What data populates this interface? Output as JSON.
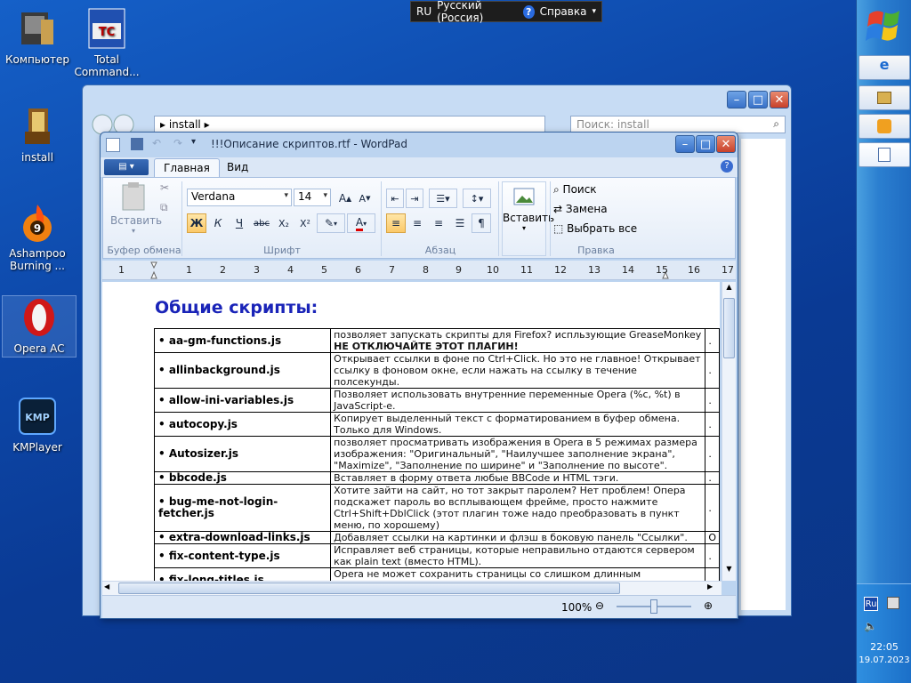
{
  "language_bar": {
    "lang_code": "RU",
    "lang_name": "Русский (Россия)",
    "help_label": "Справка"
  },
  "desktop_icons": [
    {
      "label_line1": "Компьютер",
      "label_line2": ""
    },
    {
      "label_line1": "Total",
      "label_line2": "Command..."
    },
    {
      "label_line1": "install",
      "label_line2": ""
    },
    {
      "label_line1": "Ashampoo",
      "label_line2": "Burning ..."
    },
    {
      "label_line1": "Opera AC",
      "label_line2": ""
    },
    {
      "label_line1": "KMPlayer",
      "label_line2": ""
    }
  ],
  "explorer": {
    "path": "install",
    "search_placeholder": "Поиск: install"
  },
  "wordpad": {
    "title": "!!!Описание скриптов.rtf - WordPad",
    "tabs": [
      "Главная",
      "Вид"
    ],
    "clipboard": {
      "paste_label": "Вставить",
      "group_label": "Буфер обмена"
    },
    "font": {
      "family": "Verdana",
      "size": "14",
      "group_label": "Шрифт",
      "bold": "Ж",
      "italic": "К",
      "underline": "Ч",
      "strike": "abc",
      "sub": "X₂",
      "sup": "X²"
    },
    "paragraph": {
      "group_label": "Абзац"
    },
    "insert": {
      "label": "Вставить"
    },
    "editing": {
      "find": "Поиск",
      "replace": "Замена",
      "select_all": "Выбрать все",
      "group_label": "Правка"
    },
    "ruler_numbers": [
      "1",
      "1",
      "2",
      "3",
      "4",
      "5",
      "6",
      "7",
      "8",
      "9",
      "10",
      "11",
      "12",
      "13",
      "14",
      "15",
      "16",
      "17"
    ],
    "zoom": "100%"
  },
  "document": {
    "heading": "Общие скрипты:",
    "rows": [
      {
        "name": "aa-gm-functions.js",
        "desc": "позволяет запускать скрипты для Firefox? испльзующие GreaseMonkey",
        "desc_bold": "НЕ ОТКЛЮЧАЙТЕ ЭТОТ ПЛАГИН!",
        "extra": "."
      },
      {
        "name": "allinbackground.js",
        "desc": "Открывает ссылки в фоне по Ctrl+Click. Но это не главное! Открывает ссылку в фоновом окне, если нажать на ссылку в течение полсекунды.",
        "desc_bold": "",
        "extra": "."
      },
      {
        "name": "allow-ini-variables.js",
        "desc": "Позволяет использовать внутренние переменные Opera (%c, %t) в JavaScript-e.",
        "desc_bold": "",
        "extra": "."
      },
      {
        "name": "autocopy.js",
        "desc": "Копирует выделенный текст с форматированием в буфер обмена. Только для Windows.",
        "desc_bold": "",
        "extra": "."
      },
      {
        "name": "Autosizer.js",
        "desc": "позволяет просматривать изображения в Opera в 5 режимах размера изображения: \"Оригинальный\", \"Наилучшее заполнение экрана\", \"Maximize\", \"Заполнение по ширине\" и \"Заполнение по высоте\".",
        "desc_bold": "",
        "extra": "."
      },
      {
        "name": "bbcode.js",
        "desc": "Вставляет в форму ответа любые BBCode и HTML тэги.",
        "desc_bold": "",
        "extra": "."
      },
      {
        "name": "bug-me-not-login-fetcher.js",
        "desc": "Хотите зайти на сайт, но тот закрыт паролем? Нет проблем! Опера подскажет пароль во всплывающем фрейме, просто нажмите Ctrl+Shift+DblClick (этот плагин тоже надо преобразовать в пункт меню, по хорошему)",
        "desc_bold": "",
        "extra": "."
      },
      {
        "name": "extra-download-links.js",
        "desc": "Добавляет ссылки на картинки и флэш в боковую панель \"Ссылки\".",
        "desc_bold": "",
        "extra": "О"
      },
      {
        "name": "fix-content-type.js",
        "desc": "Исправляет веб страницы, которые неправильно отдаются сервером как plain text (вместо HTML).",
        "desc_bold": "",
        "extra": "."
      },
      {
        "name": "fix-long-titles.js",
        "desc": "Opera не может сохранить страницы со слишком длинным заголовком.",
        "desc_bold": "",
        "extra": ""
      }
    ]
  },
  "tray": {
    "lang": "Ru",
    "time": "22:05",
    "date": "19.07.2023"
  }
}
